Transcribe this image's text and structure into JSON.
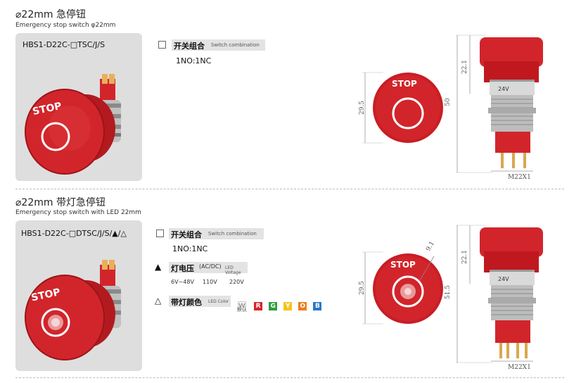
{
  "section1": {
    "title": "⌀22mm 急停钮",
    "subtitle": "Emergency stop switch φ22mm",
    "model": "HBS1-D22C-□TSC/J/S",
    "option_label": "开关组合",
    "option_en": "Switch combination",
    "option_value": "1NO:1NC",
    "button_text": "STOP",
    "dims": {
      "top_height": "22.1",
      "total": "50",
      "cap_diameter": "29.5",
      "thread": "M22X1",
      "body_text": "24V"
    }
  },
  "section2": {
    "title": "⌀22mm 带灯急停钮",
    "subtitle": "Emergency stop switch with LED 22mm",
    "model": "HBS1-D22C-□DTSC/J/S/▲/△",
    "options": [
      {
        "symbol": "□",
        "label": "开关组合",
        "en": "Switch combination",
        "values": [
          "1NO:1NC"
        ]
      },
      {
        "symbol": "▲",
        "label": "灯电压",
        "paren": "(AC/DC)",
        "en": "LED Voltage",
        "values": [
          "6V~48V",
          "110V",
          "220V"
        ]
      },
      {
        "symbol": "△",
        "label": "带灯颜色",
        "en": "LED Color",
        "colors": [
          {
            "letter": "W",
            "color": "#ffffff",
            "text": "#999999",
            "note": "默认"
          },
          {
            "letter": "R",
            "color": "#d7262b",
            "text": "#ffffff"
          },
          {
            "letter": "G",
            "color": "#2f9e3f",
            "text": "#ffffff"
          },
          {
            "letter": "Y",
            "color": "#f2c41e",
            "text": "#ffffff"
          },
          {
            "letter": "O",
            "color": "#ee7d1b",
            "text": "#ffffff"
          },
          {
            "letter": "B",
            "color": "#2a78c8",
            "text": "#ffffff"
          }
        ]
      }
    ],
    "button_text": "STOP",
    "dims": {
      "top_height": "22.1",
      "total": "51.5",
      "cap_diameter": "29.5",
      "led": "9.1",
      "thread": "M22X1",
      "body_text": "24V"
    }
  },
  "colors": {
    "red": "#d1252b",
    "red_dark": "#9d1418",
    "card_bg": "#dedede",
    "silver": "#c8c8c8"
  }
}
